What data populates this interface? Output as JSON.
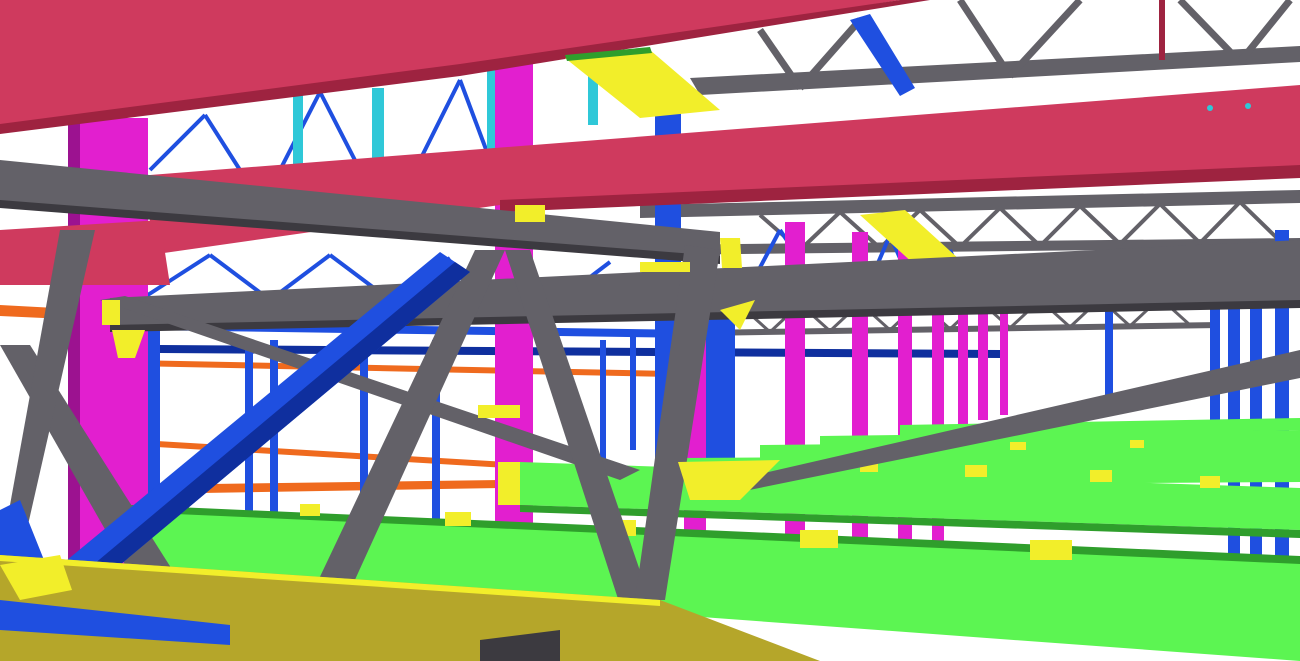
{
  "scene": {
    "colors": {
      "background": "#ffffff",
      "girder_red": "#cf3a5e",
      "girder_red_dark": "#9e2340",
      "truss_gray": "#636168",
      "truss_gray_dark": "#3c3a40",
      "brace_blue": "#1f4fe0",
      "brace_blue_dark": "#0f2f9e",
      "column_magenta": "#e21fcf",
      "column_magenta_dark": "#9c1290",
      "beam_green": "#5cf552",
      "beam_green_dark": "#2f9e2c",
      "plate_yellow": "#f2ee2a",
      "plate_olive": "#b5a62a",
      "joist_orange": "#ef6a1e",
      "cyan_post": "#2fc8d8"
    }
  }
}
